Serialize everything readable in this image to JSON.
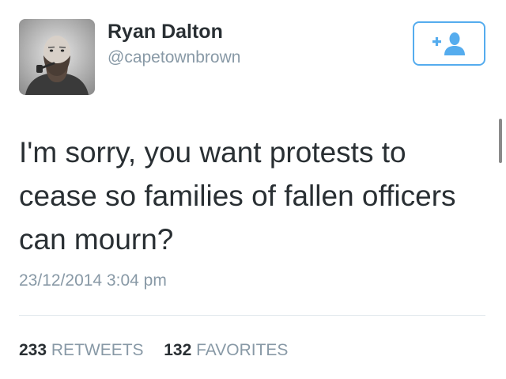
{
  "tweet": {
    "author": {
      "display_name": "Ryan Dalton",
      "handle": "@capetownbrown",
      "avatar_icon": "user-avatar-photo"
    },
    "follow_button": {
      "icon": "add-user-icon",
      "color": "#55acee"
    },
    "text_lines": [
      "I'm sorry, you want protests to",
      "cease so families of fallen officers",
      "can mourn?"
    ],
    "timestamp": "23/12/2014 3:04 pm",
    "stats": {
      "retweets_count": "233",
      "retweets_label": "RETWEETS",
      "favorites_count": "132",
      "favorites_label": "FAVORITES"
    }
  },
  "colors": {
    "text": "#292f33",
    "secondary": "#8899a6",
    "accent": "#55acee",
    "divider": "#e1e8ed"
  }
}
